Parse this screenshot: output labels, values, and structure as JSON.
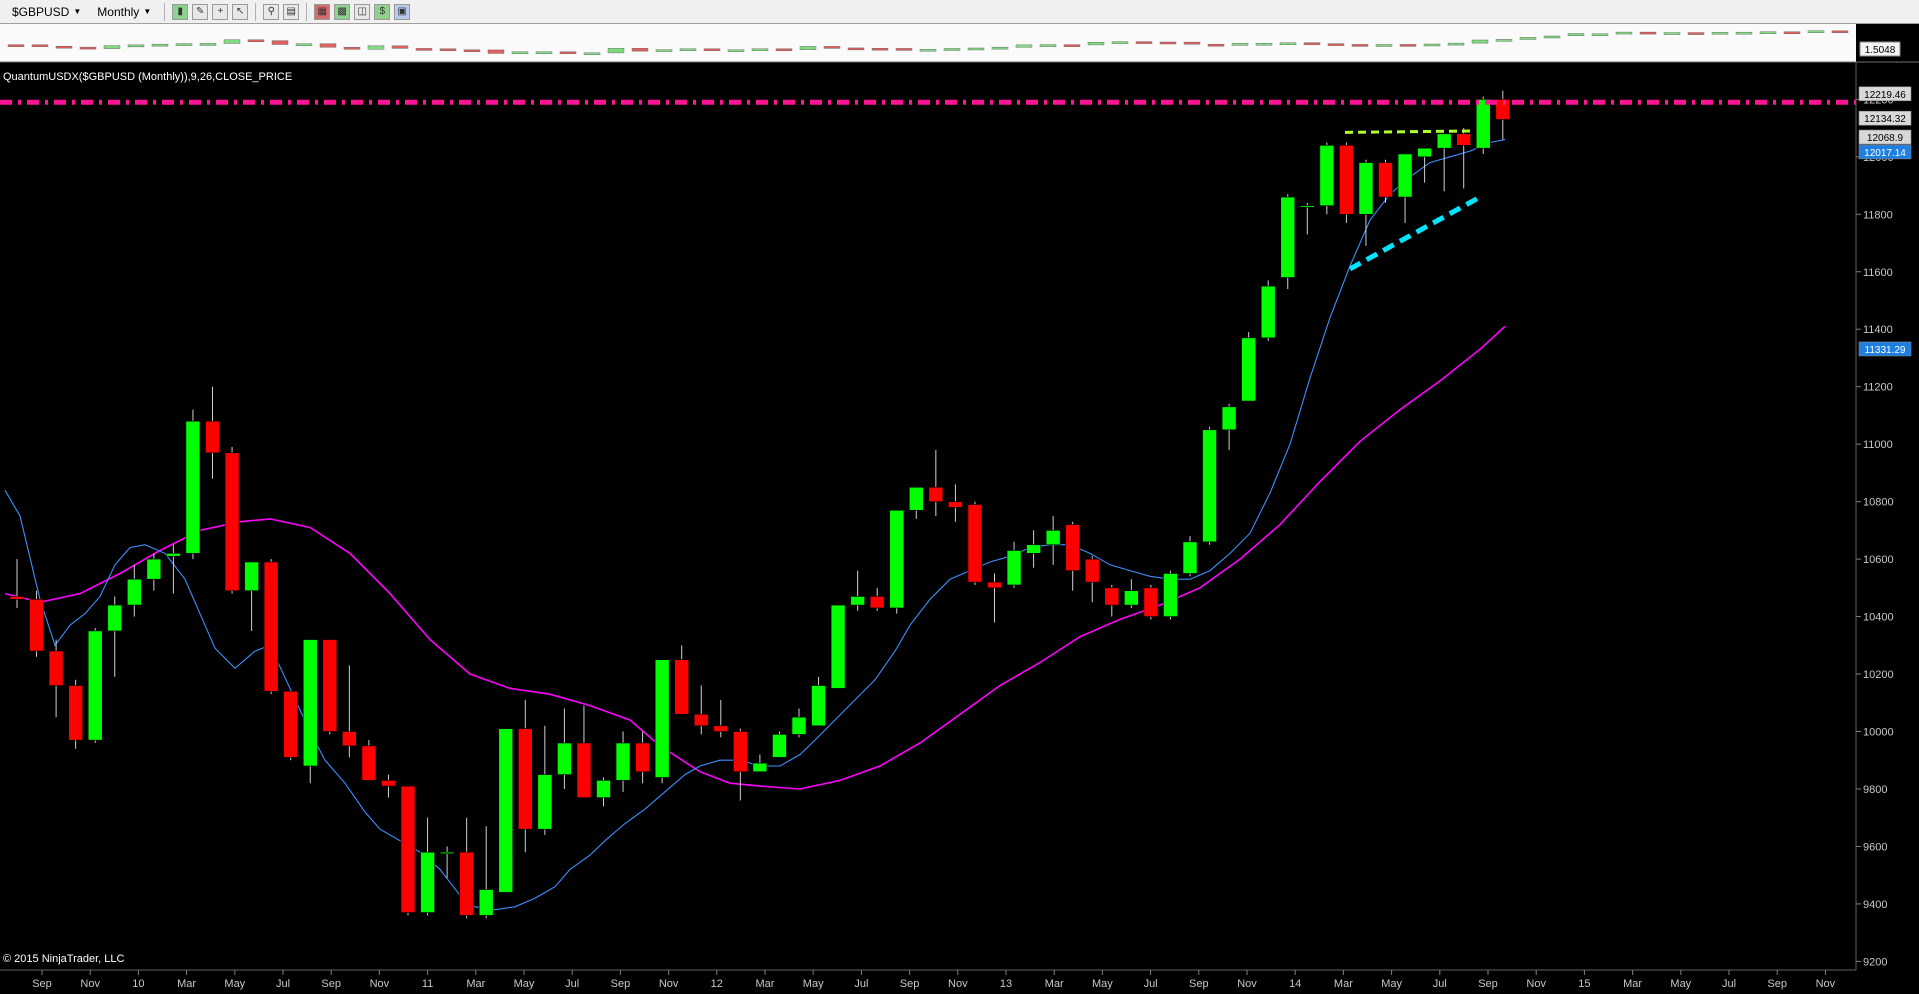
{
  "toolbar": {
    "instrument": "$GBPUSD",
    "period": "Monthly",
    "icons": [
      "bar-style-icon",
      "pencil-draw-icon",
      "crosshair-icon",
      "pointer-icon",
      "zoom-icon",
      "data-box-icon",
      "properties-icon",
      "strategy-icon",
      "chart-trader-icon",
      "window-icon"
    ]
  },
  "colors": {
    "background": "#000000",
    "up": "#00ff00",
    "down": "#ff0000",
    "fast_ma": "#3d8fff",
    "slow_ma": "#ff00ff",
    "resistance": "#ff1493",
    "green_trend": "#adff2f",
    "cyan_trend": "#00e5ff"
  },
  "mini_panel": {
    "price_label": "1.5048"
  },
  "indicator_label": "QuantumUSDX($GBPUSD (Monthly)),9,26,CLOSE_PRICE",
  "copyright": "© 2015 NinjaTrader, LLC",
  "price_badges": [
    {
      "value": "12219.46",
      "kind": "gray"
    },
    {
      "value": "12134.32",
      "kind": "gray"
    },
    {
      "value": "12068.9",
      "kind": "gray"
    },
    {
      "value": "12017.14",
      "kind": "blue"
    },
    {
      "value": "11331.29",
      "kind": "blue"
    }
  ],
  "chart_data": {
    "type": "candlestick",
    "ylim": [
      9170,
      12330
    ],
    "y_ticks": [
      "9200",
      "9400",
      "9600",
      "9800",
      "10000",
      "10200",
      "10400",
      "10600",
      "10800",
      "11000",
      "11200",
      "11400",
      "11600",
      "11800",
      "12000",
      "12200"
    ],
    "x_labels": [
      "Sep",
      "Nov",
      "10",
      "Mar",
      "May",
      "Jul",
      "Sep",
      "Nov",
      "11",
      "Mar",
      "May",
      "Jul",
      "Sep",
      "Nov",
      "12",
      "Mar",
      "May",
      "Jul",
      "Sep",
      "Nov",
      "13",
      "Mar",
      "May",
      "Jul",
      "Sep",
      "Nov",
      "14",
      "Mar",
      "May",
      "Jul",
      "Sep",
      "Nov",
      "15",
      "Mar",
      "May",
      "Jul",
      "Sep",
      "Nov"
    ],
    "candles": [
      [
        10470,
        10600,
        10430,
        10460
      ],
      [
        10460,
        10490,
        10260,
        10280
      ],
      [
        10280,
        10320,
        10050,
        10160
      ],
      [
        10160,
        10180,
        9940,
        9970
      ],
      [
        9970,
        10360,
        9960,
        10350
      ],
      [
        10350,
        10470,
        10190,
        10440
      ],
      [
        10440,
        10580,
        10400,
        10530
      ],
      [
        10530,
        10620,
        10490,
        10600
      ],
      [
        10610,
        10650,
        10480,
        10620
      ],
      [
        10620,
        11120,
        10600,
        11080
      ],
      [
        11080,
        11200,
        10880,
        10970
      ],
      [
        10970,
        10990,
        10480,
        10490
      ],
      [
        10490,
        10590,
        10350,
        10590
      ],
      [
        10590,
        10600,
        10130,
        10140
      ],
      [
        10140,
        10140,
        9900,
        9910
      ],
      [
        9880,
        10320,
        9820,
        10320
      ],
      [
        10320,
        10320,
        9990,
        10000
      ],
      [
        10000,
        10230,
        9910,
        9950
      ],
      [
        9950,
        9970,
        9830,
        9830
      ],
      [
        9830,
        9850,
        9770,
        9810
      ],
      [
        9810,
        9810,
        9360,
        9370
      ],
      [
        9370,
        9700,
        9360,
        9580
      ],
      [
        9580,
        9600,
        9490,
        9580
      ],
      [
        9580,
        9700,
        9350,
        9360
      ],
      [
        9360,
        9670,
        9350,
        9450
      ],
      [
        9440,
        10000,
        9440,
        10010
      ],
      [
        10010,
        10110,
        9580,
        9660
      ],
      [
        9660,
        10020,
        9640,
        9850
      ],
      [
        9850,
        10080,
        9800,
        9960
      ],
      [
        9960,
        10090,
        9770,
        9770
      ],
      [
        9770,
        9840,
        9740,
        9830
      ],
      [
        9830,
        10000,
        9790,
        9960
      ],
      [
        9960,
        10000,
        9820,
        9860
      ],
      [
        9840,
        10250,
        9820,
        10250
      ],
      [
        10250,
        10300,
        10060,
        10060
      ],
      [
        10060,
        10160,
        9990,
        10020
      ],
      [
        10020,
        10110,
        9980,
        10000
      ],
      [
        10000,
        10010,
        9760,
        9860
      ],
      [
        9860,
        9920,
        9860,
        9890
      ],
      [
        9910,
        10000,
        9910,
        9990
      ],
      [
        9990,
        10080,
        9980,
        10050
      ],
      [
        10020,
        10190,
        10020,
        10160
      ],
      [
        10150,
        10440,
        10150,
        10440
      ],
      [
        10440,
        10560,
        10420,
        10470
      ],
      [
        10470,
        10500,
        10420,
        10430
      ],
      [
        10430,
        10770,
        10410,
        10770
      ],
      [
        10770,
        10850,
        10740,
        10850
      ],
      [
        10850,
        10980,
        10750,
        10800
      ],
      [
        10800,
        10860,
        10730,
        10780
      ],
      [
        10790,
        10800,
        10510,
        10520
      ],
      [
        10520,
        10550,
        10380,
        10500
      ],
      [
        10510,
        10660,
        10500,
        10630
      ],
      [
        10620,
        10700,
        10570,
        10650
      ],
      [
        10650,
        10750,
        10580,
        10700
      ],
      [
        10720,
        10730,
        10490,
        10560
      ],
      [
        10600,
        10610,
        10450,
        10520
      ],
      [
        10500,
        10510,
        10400,
        10440
      ],
      [
        10440,
        10530,
        10430,
        10490
      ],
      [
        10500,
        10510,
        10390,
        10400
      ],
      [
        10400,
        10560,
        10390,
        10550
      ],
      [
        10550,
        10680,
        10540,
        10660
      ],
      [
        10660,
        11060,
        10650,
        11050
      ],
      [
        11050,
        11140,
        10980,
        11130
      ],
      [
        11150,
        11390,
        11150,
        11370
      ],
      [
        11370,
        11570,
        11360,
        11550
      ],
      [
        11580,
        11870,
        11540,
        11860
      ],
      [
        11830,
        11840,
        11730,
        11830
      ],
      [
        11830,
        12050,
        11800,
        12040
      ],
      [
        12040,
        12050,
        11770,
        11800
      ],
      [
        11800,
        11990,
        11690,
        11980
      ],
      [
        11980,
        11990,
        11840,
        11860
      ],
      [
        11860,
        12000,
        11770,
        12010
      ],
      [
        12000,
        12030,
        11910,
        12030
      ],
      [
        12030,
        12070,
        11880,
        12080
      ],
      [
        12080,
        12100,
        11890,
        12040
      ],
      [
        12030,
        12210,
        12010,
        12200
      ],
      [
        12200,
        12230,
        12060,
        12130
      ]
    ],
    "candle_x_start": 5,
    "candle_x_step": 19.55,
    "fast_ma": [
      [
        5,
        10840
      ],
      [
        20,
        10750
      ],
      [
        40,
        10460
      ],
      [
        55,
        10300
      ],
      [
        70,
        10370
      ],
      [
        85,
        10410
      ],
      [
        100,
        10470
      ],
      [
        115,
        10580
      ],
      [
        130,
        10640
      ],
      [
        145,
        10650
      ],
      [
        165,
        10620
      ],
      [
        185,
        10530
      ],
      [
        200,
        10410
      ],
      [
        215,
        10290
      ],
      [
        235,
        10220
      ],
      [
        255,
        10280
      ],
      [
        270,
        10300
      ],
      [
        290,
        10150
      ],
      [
        310,
        10000
      ],
      [
        325,
        9900
      ],
      [
        345,
        9820
      ],
      [
        365,
        9720
      ],
      [
        380,
        9660
      ],
      [
        400,
        9620
      ],
      [
        420,
        9580
      ],
      [
        440,
        9520
      ],
      [
        460,
        9430
      ],
      [
        475,
        9390
      ],
      [
        495,
        9380
      ],
      [
        515,
        9390
      ],
      [
        535,
        9420
      ],
      [
        555,
        9460
      ],
      [
        570,
        9520
      ],
      [
        590,
        9570
      ],
      [
        605,
        9620
      ],
      [
        625,
        9680
      ],
      [
        645,
        9730
      ],
      [
        665,
        9790
      ],
      [
        685,
        9850
      ],
      [
        700,
        9880
      ],
      [
        720,
        9900
      ],
      [
        740,
        9900
      ],
      [
        760,
        9880
      ],
      [
        780,
        9880
      ],
      [
        800,
        9920
      ],
      [
        815,
        9970
      ],
      [
        835,
        10040
      ],
      [
        855,
        10110
      ],
      [
        875,
        10180
      ],
      [
        895,
        10280
      ],
      [
        910,
        10370
      ],
      [
        930,
        10460
      ],
      [
        950,
        10530
      ],
      [
        970,
        10560
      ],
      [
        990,
        10590
      ],
      [
        1010,
        10610
      ],
      [
        1030,
        10640
      ],
      [
        1050,
        10650
      ],
      [
        1070,
        10650
      ],
      [
        1090,
        10620
      ],
      [
        1110,
        10580
      ],
      [
        1130,
        10560
      ],
      [
        1150,
        10540
      ],
      [
        1170,
        10530
      ],
      [
        1190,
        10530
      ],
      [
        1210,
        10560
      ],
      [
        1230,
        10620
      ],
      [
        1250,
        10690
      ],
      [
        1270,
        10830
      ],
      [
        1290,
        11000
      ],
      [
        1310,
        11230
      ],
      [
        1330,
        11440
      ],
      [
        1350,
        11620
      ],
      [
        1370,
        11780
      ],
      [
        1390,
        11870
      ],
      [
        1410,
        11930
      ],
      [
        1430,
        11980
      ],
      [
        1450,
        12000
      ],
      [
        1470,
        12020
      ],
      [
        1490,
        12050
      ],
      [
        1505,
        12060
      ]
    ],
    "slow_ma": [
      [
        5,
        10480
      ],
      [
        40,
        10450
      ],
      [
        80,
        10480
      ],
      [
        120,
        10550
      ],
      [
        160,
        10630
      ],
      [
        200,
        10700
      ],
      [
        240,
        10730
      ],
      [
        270,
        10740
      ],
      [
        310,
        10710
      ],
      [
        350,
        10620
      ],
      [
        390,
        10480
      ],
      [
        430,
        10320
      ],
      [
        470,
        10200
      ],
      [
        510,
        10150
      ],
      [
        550,
        10130
      ],
      [
        590,
        10090
      ],
      [
        630,
        10040
      ],
      [
        660,
        9950
      ],
      [
        700,
        9860
      ],
      [
        730,
        9820
      ],
      [
        760,
        9810
      ],
      [
        800,
        9800
      ],
      [
        840,
        9830
      ],
      [
        880,
        9880
      ],
      [
        920,
        9960
      ],
      [
        960,
        10060
      ],
      [
        1000,
        10160
      ],
      [
        1040,
        10240
      ],
      [
        1080,
        10330
      ],
      [
        1120,
        10390
      ],
      [
        1160,
        10440
      ],
      [
        1200,
        10500
      ],
      [
        1240,
        10600
      ],
      [
        1280,
        10720
      ],
      [
        1320,
        10870
      ],
      [
        1360,
        11010
      ],
      [
        1400,
        11120
      ],
      [
        1440,
        11220
      ],
      [
        1480,
        11330
      ],
      [
        1505,
        11410
      ]
    ],
    "resistance_level": 12190,
    "green_trend": [
      [
        1345,
        12085
      ],
      [
        1475,
        12090
      ]
    ],
    "cyan_trend": [
      [
        1350,
        11610
      ],
      [
        1480,
        11860
      ]
    ]
  }
}
